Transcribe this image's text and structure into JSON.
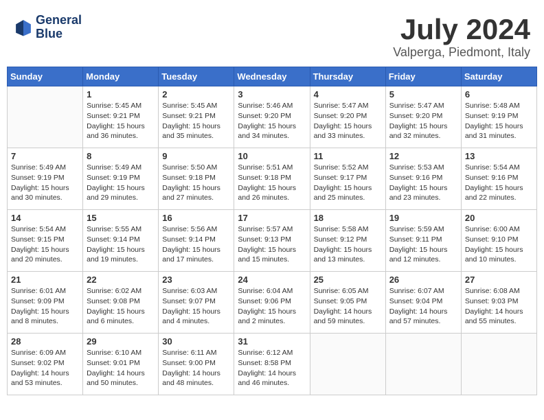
{
  "header": {
    "logo_line1": "General",
    "logo_line2": "Blue",
    "month_title": "July 2024",
    "location": "Valperga, Piedmont, Italy"
  },
  "weekdays": [
    "Sunday",
    "Monday",
    "Tuesday",
    "Wednesday",
    "Thursday",
    "Friday",
    "Saturday"
  ],
  "weeks": [
    [
      {
        "day": "",
        "info": ""
      },
      {
        "day": "1",
        "info": "Sunrise: 5:45 AM\nSunset: 9:21 PM\nDaylight: 15 hours\nand 36 minutes."
      },
      {
        "day": "2",
        "info": "Sunrise: 5:45 AM\nSunset: 9:21 PM\nDaylight: 15 hours\nand 35 minutes."
      },
      {
        "day": "3",
        "info": "Sunrise: 5:46 AM\nSunset: 9:20 PM\nDaylight: 15 hours\nand 34 minutes."
      },
      {
        "day": "4",
        "info": "Sunrise: 5:47 AM\nSunset: 9:20 PM\nDaylight: 15 hours\nand 33 minutes."
      },
      {
        "day": "5",
        "info": "Sunrise: 5:47 AM\nSunset: 9:20 PM\nDaylight: 15 hours\nand 32 minutes."
      },
      {
        "day": "6",
        "info": "Sunrise: 5:48 AM\nSunset: 9:19 PM\nDaylight: 15 hours\nand 31 minutes."
      }
    ],
    [
      {
        "day": "7",
        "info": "Sunrise: 5:49 AM\nSunset: 9:19 PM\nDaylight: 15 hours\nand 30 minutes."
      },
      {
        "day": "8",
        "info": "Sunrise: 5:49 AM\nSunset: 9:19 PM\nDaylight: 15 hours\nand 29 minutes."
      },
      {
        "day": "9",
        "info": "Sunrise: 5:50 AM\nSunset: 9:18 PM\nDaylight: 15 hours\nand 27 minutes."
      },
      {
        "day": "10",
        "info": "Sunrise: 5:51 AM\nSunset: 9:18 PM\nDaylight: 15 hours\nand 26 minutes."
      },
      {
        "day": "11",
        "info": "Sunrise: 5:52 AM\nSunset: 9:17 PM\nDaylight: 15 hours\nand 25 minutes."
      },
      {
        "day": "12",
        "info": "Sunrise: 5:53 AM\nSunset: 9:16 PM\nDaylight: 15 hours\nand 23 minutes."
      },
      {
        "day": "13",
        "info": "Sunrise: 5:54 AM\nSunset: 9:16 PM\nDaylight: 15 hours\nand 22 minutes."
      }
    ],
    [
      {
        "day": "14",
        "info": "Sunrise: 5:54 AM\nSunset: 9:15 PM\nDaylight: 15 hours\nand 20 minutes."
      },
      {
        "day": "15",
        "info": "Sunrise: 5:55 AM\nSunset: 9:14 PM\nDaylight: 15 hours\nand 19 minutes."
      },
      {
        "day": "16",
        "info": "Sunrise: 5:56 AM\nSunset: 9:14 PM\nDaylight: 15 hours\nand 17 minutes."
      },
      {
        "day": "17",
        "info": "Sunrise: 5:57 AM\nSunset: 9:13 PM\nDaylight: 15 hours\nand 15 minutes."
      },
      {
        "day": "18",
        "info": "Sunrise: 5:58 AM\nSunset: 9:12 PM\nDaylight: 15 hours\nand 13 minutes."
      },
      {
        "day": "19",
        "info": "Sunrise: 5:59 AM\nSunset: 9:11 PM\nDaylight: 15 hours\nand 12 minutes."
      },
      {
        "day": "20",
        "info": "Sunrise: 6:00 AM\nSunset: 9:10 PM\nDaylight: 15 hours\nand 10 minutes."
      }
    ],
    [
      {
        "day": "21",
        "info": "Sunrise: 6:01 AM\nSunset: 9:09 PM\nDaylight: 15 hours\nand 8 minutes."
      },
      {
        "day": "22",
        "info": "Sunrise: 6:02 AM\nSunset: 9:08 PM\nDaylight: 15 hours\nand 6 minutes."
      },
      {
        "day": "23",
        "info": "Sunrise: 6:03 AM\nSunset: 9:07 PM\nDaylight: 15 hours\nand 4 minutes."
      },
      {
        "day": "24",
        "info": "Sunrise: 6:04 AM\nSunset: 9:06 PM\nDaylight: 15 hours\nand 2 minutes."
      },
      {
        "day": "25",
        "info": "Sunrise: 6:05 AM\nSunset: 9:05 PM\nDaylight: 14 hours\nand 59 minutes."
      },
      {
        "day": "26",
        "info": "Sunrise: 6:07 AM\nSunset: 9:04 PM\nDaylight: 14 hours\nand 57 minutes."
      },
      {
        "day": "27",
        "info": "Sunrise: 6:08 AM\nSunset: 9:03 PM\nDaylight: 14 hours\nand 55 minutes."
      }
    ],
    [
      {
        "day": "28",
        "info": "Sunrise: 6:09 AM\nSunset: 9:02 PM\nDaylight: 14 hours\nand 53 minutes."
      },
      {
        "day": "29",
        "info": "Sunrise: 6:10 AM\nSunset: 9:01 PM\nDaylight: 14 hours\nand 50 minutes."
      },
      {
        "day": "30",
        "info": "Sunrise: 6:11 AM\nSunset: 9:00 PM\nDaylight: 14 hours\nand 48 minutes."
      },
      {
        "day": "31",
        "info": "Sunrise: 6:12 AM\nSunset: 8:58 PM\nDaylight: 14 hours\nand 46 minutes."
      },
      {
        "day": "",
        "info": ""
      },
      {
        "day": "",
        "info": ""
      },
      {
        "day": "",
        "info": ""
      }
    ]
  ]
}
